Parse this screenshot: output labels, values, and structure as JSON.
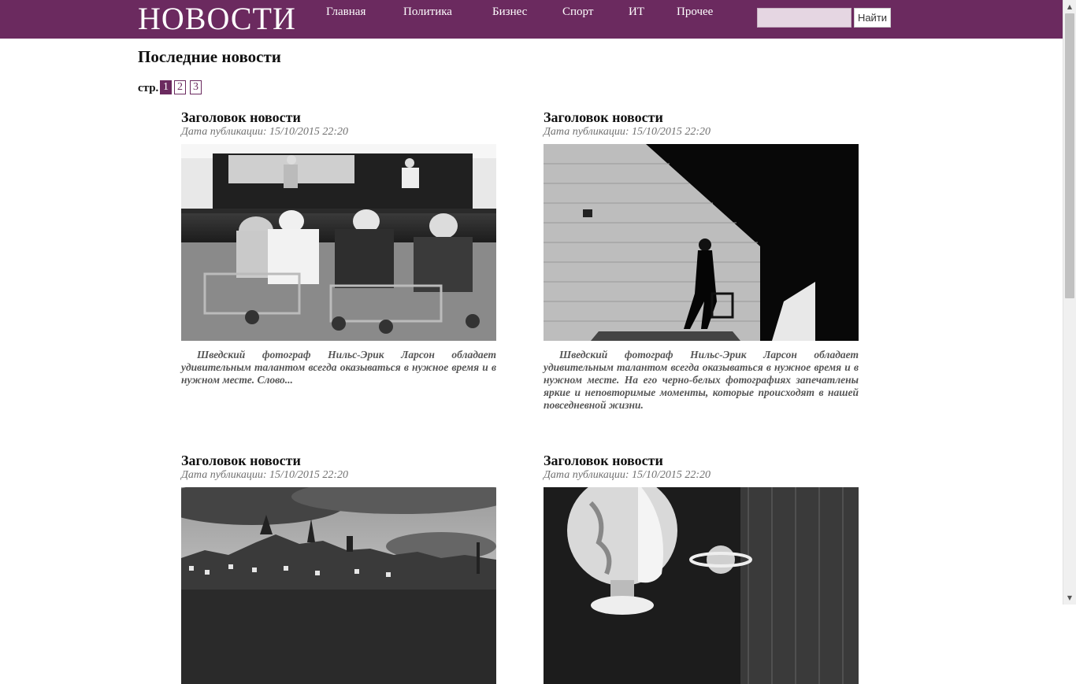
{
  "header": {
    "logo": "НОВОСТИ",
    "nav": [
      "Главная",
      "Политика",
      "Бизнес",
      "Спорт",
      "ИТ",
      "Прочее"
    ],
    "search_placeholder": "",
    "search_button": "Найти"
  },
  "main": {
    "title": "Последние новости",
    "pager": {
      "label": "стр.",
      "pages": [
        "1",
        "2",
        "3"
      ],
      "current": "1"
    }
  },
  "articles": [
    {
      "title": "Заголовок новости",
      "date": "Дата публикации: 15/10/2015 22:20",
      "image": "band-concert-photo",
      "excerpt": "Шведский фотограф Нильс-Эрик Ларсон обладает удивительным талантом всегда оказываться в нужное время и в нужном месте. Слово..."
    },
    {
      "title": "Заголовок новости",
      "date": "Дата публикации: 15/10/2015 22:20",
      "image": "man-walker-shadow-photo",
      "excerpt": "Шведский фотограф Нильс-Эрик Ларсон обладает удивительным талантом всегда оказываться в нужное время и в нужном месте. На его черно-белых фотографиях запечатлены яркие и неповторимые моменты, которые происходят в нашей повседневной жизни."
    },
    {
      "title": "Заголовок новости",
      "date": "Дата публикации: 15/10/2015 22:20",
      "image": "city-skyline-photo",
      "excerpt": ""
    },
    {
      "title": "Заголовок новости",
      "date": "Дата публикации: 15/10/2015 22:20",
      "image": "globe-head-photo",
      "excerpt": ""
    }
  ],
  "colors": {
    "brand": "#6b2a5f",
    "date": "#6f6f6f"
  }
}
